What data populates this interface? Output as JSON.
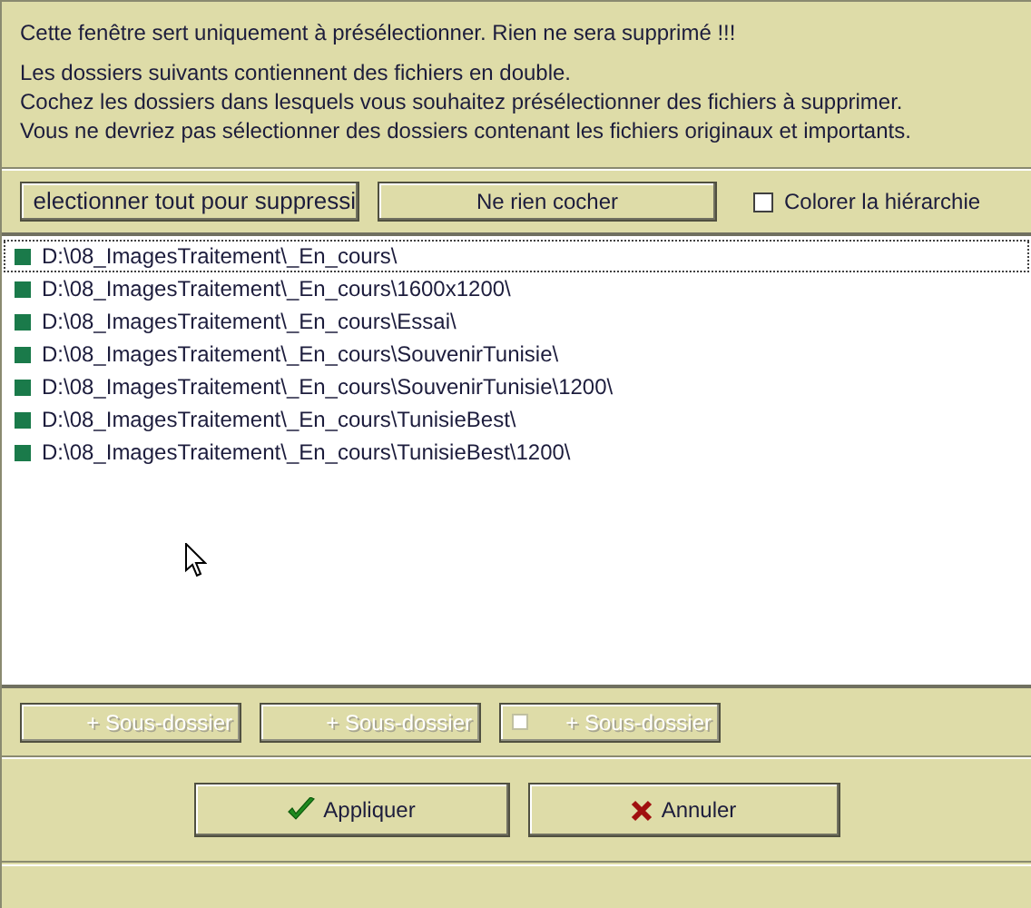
{
  "intro": {
    "warning": "Cette fenêtre sert uniquement à présélectionner. Rien ne sera supprimé !!!",
    "lines": [
      "Les dossiers suivants contiennent des fichiers en double.",
      "Cochez les dossiers dans lesquels vous souhaitez présélectionner des fichiers à supprimer.",
      "Vous ne devriez pas sélectionner des dossiers contenant les fichiers originaux et importants."
    ]
  },
  "toolbar": {
    "select_all_button": "electionner tout pour suppressi",
    "uncheck_button": "Ne rien cocher",
    "color_hierarchy": {
      "label": "Colorer la hiérarchie",
      "checked": false
    }
  },
  "folders": [
    {
      "path": "D:\\08_ImagesTraitement\\_En_cours\\",
      "marked": true,
      "selected": true
    },
    {
      "path": "D:\\08_ImagesTraitement\\_En_cours\\1600x1200\\",
      "marked": true,
      "selected": false
    },
    {
      "path": "D:\\08_ImagesTraitement\\_En_cours\\Essai\\",
      "marked": true,
      "selected": false
    },
    {
      "path": "D:\\08_ImagesTraitement\\_En_cours\\SouvenirTunisie\\",
      "marked": true,
      "selected": false
    },
    {
      "path": "D:\\08_ImagesTraitement\\_En_cours\\SouvenirTunisie\\1200\\",
      "marked": true,
      "selected": false
    },
    {
      "path": "D:\\08_ImagesTraitement\\_En_cours\\TunisieBest\\",
      "marked": true,
      "selected": false
    },
    {
      "path": "D:\\08_ImagesTraitement\\_En_cours\\TunisieBest\\1200\\",
      "marked": true,
      "selected": false
    }
  ],
  "subfolder_buttons": [
    {
      "kind": "button",
      "label": "+ Sous-dossier",
      "disabled": true
    },
    {
      "kind": "button",
      "label": "+ Sous-dossier",
      "disabled": true
    },
    {
      "kind": "checkbox",
      "label": "+ Sous-dossier",
      "disabled": true
    }
  ],
  "actions": {
    "apply": "Appliquer",
    "cancel": "Annuler"
  }
}
